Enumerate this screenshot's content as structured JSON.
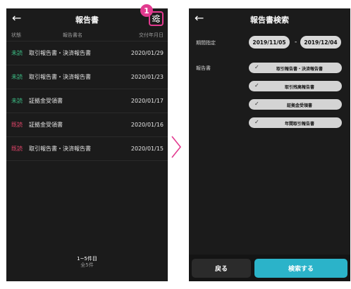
{
  "left": {
    "title": "報告書",
    "badge": "1",
    "columns": {
      "status": "状態",
      "name": "報告書名",
      "date": "交付年月日"
    },
    "rows": [
      {
        "status": "未読",
        "name": "取引報告書・決済報告書",
        "date": "2020/01/29"
      },
      {
        "status": "未読",
        "name": "取引報告書・決済報告書",
        "date": "2020/01/23"
      },
      {
        "status": "未読",
        "name": "証拠金受領書",
        "date": "2020/01/17"
      },
      {
        "status": "既読",
        "name": "証拠金受領書",
        "date": "2020/01/16"
      },
      {
        "status": "既読",
        "name": "取引報告書・決済報告書",
        "date": "2020/01/15"
      }
    ],
    "footer": {
      "range": "1~5件目",
      "total": "全5件"
    }
  },
  "right": {
    "title": "報告書検索",
    "period_label": "期間指定",
    "date_from": "2019/11/05",
    "date_sep": "-",
    "date_to": "2019/12/04",
    "report_label": "報告書",
    "chips": [
      {
        "label": "取引報告書・決済報告書"
      },
      {
        "label": "取引残高報告書"
      },
      {
        "label": "証拠金受領書"
      },
      {
        "label": "年間取引報告書"
      }
    ],
    "back_btn": "戻る",
    "search_btn": "検索する"
  },
  "colors": {
    "unread": "#3cbf86",
    "read": "#e2456a",
    "accent_pink": "#e23a8f",
    "search_btn": "#2bb3c9"
  },
  "icons": [
    "back-arrow-icon",
    "filter-icon",
    "chevron-right-icon",
    "check-icon"
  ]
}
